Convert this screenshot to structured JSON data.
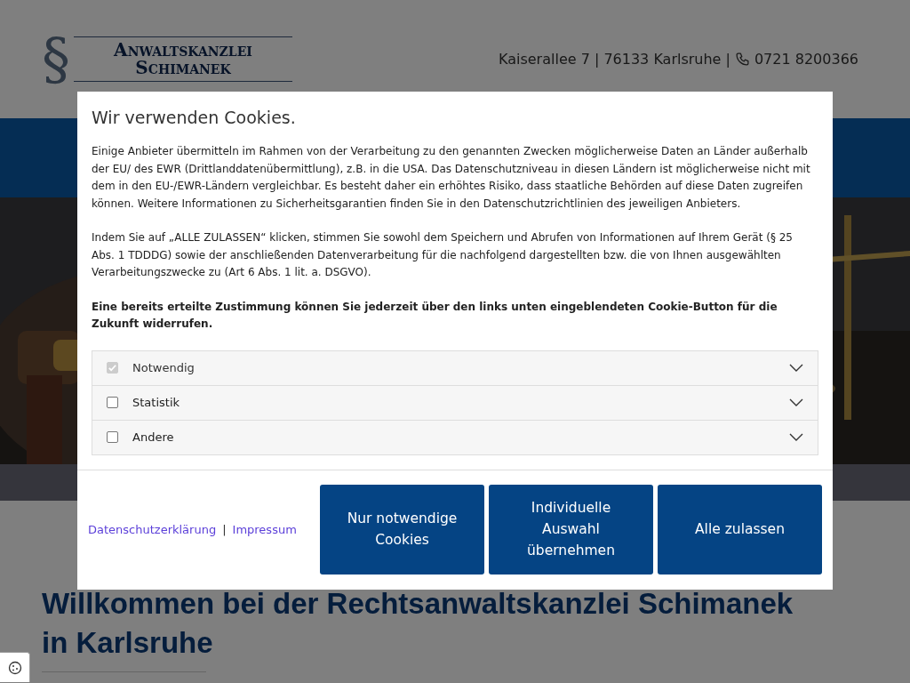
{
  "header": {
    "logo_symbol": "§",
    "logo_line_1": "Anwaltskanzlei",
    "logo_line_2": "Schimanek",
    "address": "Kaiserallee 7 | 76133 Karlsruhe |",
    "phone": "0721 8200366"
  },
  "content": {
    "heading_lines": [
      "Willkommen bei der Rechtsanwaltskanzlei Schimanek",
      "in Karlsruhe"
    ]
  },
  "cookie_dialog": {
    "title": "Wir verwenden Cookies.",
    "paragraphs": [
      "Einige Anbieter übermitteln im Rahmen von der Verarbeitung zu den genannten Zwecken möglicherweise Daten an Länder außerhalb der EU/ des EWR (Drittlanddatenübermittlung), z.B. in die USA. Das Datenschutzniveau in diesen Ländern ist möglicherweise nicht mit dem in den EU-/EWR-Ländern vergleichbar. Es besteht daher ein erhöhtes Risiko, dass staatliche Behörden auf diese Daten zugreifen können. Weitere Informationen zu Sicherheitsgarantien finden Sie in den Datenschutzrichtlinien des jeweiligen Anbieters.",
      "Indem Sie auf „ALLE ZULASSEN“ klicken, stimmen Sie sowohl dem Speichern und Abrufen von Informationen auf Ihrem Gerät (§ 25 Abs. 1 TDDDG) sowie der anschließenden Datenverarbeitung für die nachfolgend dargestellten bzw. die von Ihnen ausgewählten Verarbeitungszwecke zu (Art 6 Abs. 1 lit. a. DSGVO)."
    ],
    "notice": "Eine bereits erteilte Zustimmung können Sie jederzeit über den links unten eingeblendeten Cookie-Button für die Zukunft widerrufen.",
    "categories": [
      {
        "label": "Notwendig",
        "checked": true,
        "disabled": true,
        "expanded": false
      },
      {
        "label": "Statistik",
        "checked": false,
        "disabled": false,
        "expanded": false
      },
      {
        "label": "Andere",
        "checked": false,
        "disabled": false,
        "expanded": false
      }
    ],
    "links": [
      "Datenschutzerklärung",
      "Impressum"
    ],
    "link_separator": "|",
    "buttons": [
      "Nur notwendige Cookies",
      "Individuelle Auswahl übernehmen",
      "Alle zulassen"
    ]
  }
}
